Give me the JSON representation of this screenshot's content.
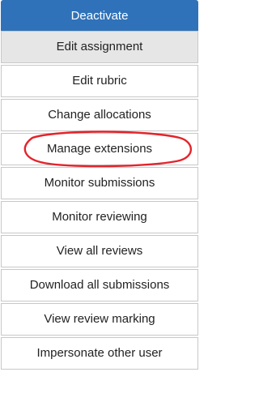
{
  "menu": {
    "items": [
      {
        "label": "Deactivate",
        "style": "primary"
      },
      {
        "label": "Edit assignment",
        "style": "hover"
      },
      {
        "label": "Edit rubric",
        "style": "normal"
      },
      {
        "label": "Change allocations",
        "style": "normal"
      },
      {
        "label": "Manage extensions",
        "style": "normal"
      },
      {
        "label": "Monitor submissions",
        "style": "normal"
      },
      {
        "label": "Monitor reviewing",
        "style": "normal"
      },
      {
        "label": "View all reviews",
        "style": "normal"
      },
      {
        "label": "Download all submissions",
        "style": "normal"
      },
      {
        "label": "View review marking",
        "style": "normal"
      },
      {
        "label": "Impersonate other user",
        "style": "normal"
      }
    ]
  },
  "colors": {
    "primary": "#2f72b9",
    "hover": "#e6e6e6",
    "border": "#c8c8c8",
    "annotation": "#e3242b"
  }
}
